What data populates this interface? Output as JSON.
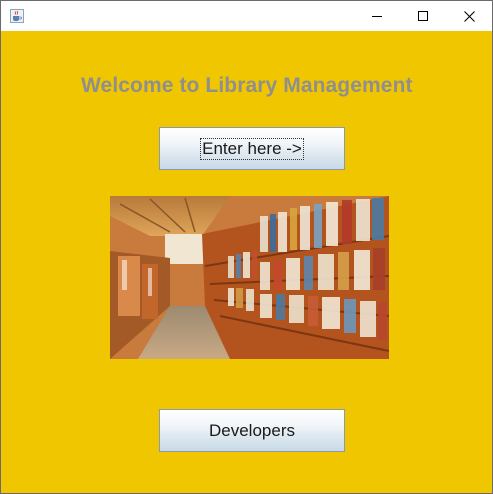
{
  "window": {
    "icon": "java-cup-icon",
    "controls": {
      "minimize": "minimize-icon",
      "maximize": "maximize-icon",
      "close": "close-icon"
    }
  },
  "main": {
    "heading": "Welcome to Library Management",
    "enter_button_label": "Enter here ->",
    "developers_button_label": "Developers",
    "image": "library-bookshelves-photo"
  },
  "colors": {
    "background": "#efc600",
    "heading": "#8f8f8f",
    "button_gradient_top": "#ffffff",
    "button_gradient_bottom": "#c8d9e6"
  }
}
